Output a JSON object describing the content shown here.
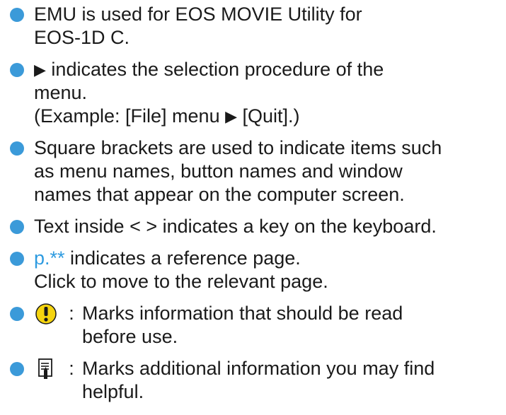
{
  "items": [
    {
      "lines": [
        "EMU is used for EOS MOVIE Utility for",
        "EOS-1D C."
      ]
    },
    {
      "line1_rest": " indicates the selection procedure of the",
      "line2": "menu.",
      "line3_a": "(Example: [File] menu ",
      "line3_b": " [Quit].)",
      "arrow": "▶"
    },
    {
      "lines": [
        "Square brackets are used to indicate items such",
        "as menu names, button names and window",
        "names that appear on the computer screen."
      ]
    },
    {
      "lines": [
        "Text inside < > indicates a key on the keyboard."
      ]
    },
    {
      "ref": "p.**",
      "ref_rest": " indicates a reference page.",
      "line2": "Click to move to the relevant page."
    },
    {
      "colon": ":",
      "lines": [
        "Marks information that should be read",
        "before use."
      ],
      "icon": "caution-icon"
    },
    {
      "colon": ":",
      "lines": [
        "Marks additional information you may find",
        "helpful."
      ],
      "icon": "memo-icon"
    }
  ],
  "colors": {
    "bullet": "#3b9ad9",
    "link": "#2e9be0",
    "caution": "#f5d40f"
  }
}
